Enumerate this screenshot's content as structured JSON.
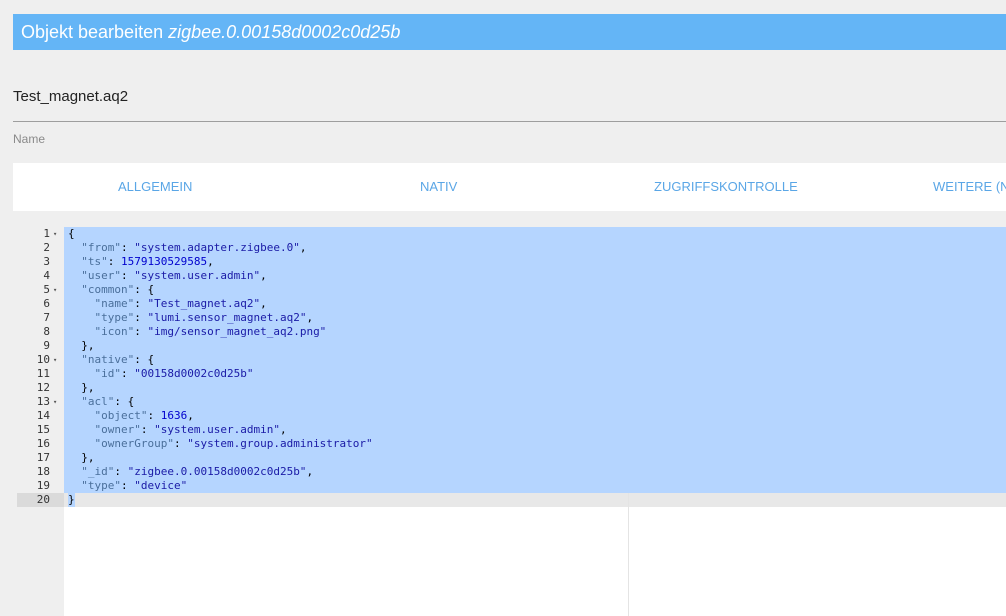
{
  "dialog": {
    "title_prefix": "Objekt bearbeiten",
    "object_id": "zigbee.0.00158d0002c0d25b"
  },
  "name_field": {
    "value": "Test_magnet.aq2",
    "label": "Name"
  },
  "tabs": [
    {
      "label": "ALLGEMEIN"
    },
    {
      "label": "NATIV"
    },
    {
      "label": "ZUGRIFFSKONTROLLE"
    },
    {
      "label": "WEITERE (NU"
    }
  ],
  "editor": {
    "lines": [
      {
        "num": "1",
        "fold": true,
        "text": "{"
      },
      {
        "num": "2",
        "fold": false,
        "text": "  \"from\": \"system.adapter.zigbee.0\","
      },
      {
        "num": "3",
        "fold": false,
        "text": "  \"ts\": 1579130529585,"
      },
      {
        "num": "4",
        "fold": false,
        "text": "  \"user\": \"system.user.admin\","
      },
      {
        "num": "5",
        "fold": true,
        "text": "  \"common\": {"
      },
      {
        "num": "6",
        "fold": false,
        "text": "    \"name\": \"Test_magnet.aq2\","
      },
      {
        "num": "7",
        "fold": false,
        "text": "    \"type\": \"lumi.sensor_magnet.aq2\","
      },
      {
        "num": "8",
        "fold": false,
        "text": "    \"icon\": \"img/sensor_magnet_aq2.png\""
      },
      {
        "num": "9",
        "fold": false,
        "text": "  },"
      },
      {
        "num": "10",
        "fold": true,
        "text": "  \"native\": {"
      },
      {
        "num": "11",
        "fold": false,
        "text": "    \"id\": \"00158d0002c0d25b\""
      },
      {
        "num": "12",
        "fold": false,
        "text": "  },"
      },
      {
        "num": "13",
        "fold": true,
        "text": "  \"acl\": {"
      },
      {
        "num": "14",
        "fold": false,
        "text": "    \"object\": 1636,"
      },
      {
        "num": "15",
        "fold": false,
        "text": "    \"owner\": \"system.user.admin\","
      },
      {
        "num": "16",
        "fold": false,
        "text": "    \"ownerGroup\": \"system.group.administrator\""
      },
      {
        "num": "17",
        "fold": false,
        "text": "  },"
      },
      {
        "num": "18",
        "fold": false,
        "text": "  \"_id\": \"zigbee.0.00158d0002c0d25b\","
      },
      {
        "num": "19",
        "fold": false,
        "text": "  \"type\": \"device\""
      },
      {
        "num": "20",
        "fold": false,
        "text": "}"
      }
    ],
    "fold_icon": "fold-arrow-down-icon"
  },
  "colors": {
    "title_bar": "#64b5f6",
    "tab_text": "#5aa6e6",
    "selection": "#b5d5ff",
    "json_key": "#4a6f9b",
    "json_string": "#1a1aa6",
    "json_number": "#0000cd"
  }
}
